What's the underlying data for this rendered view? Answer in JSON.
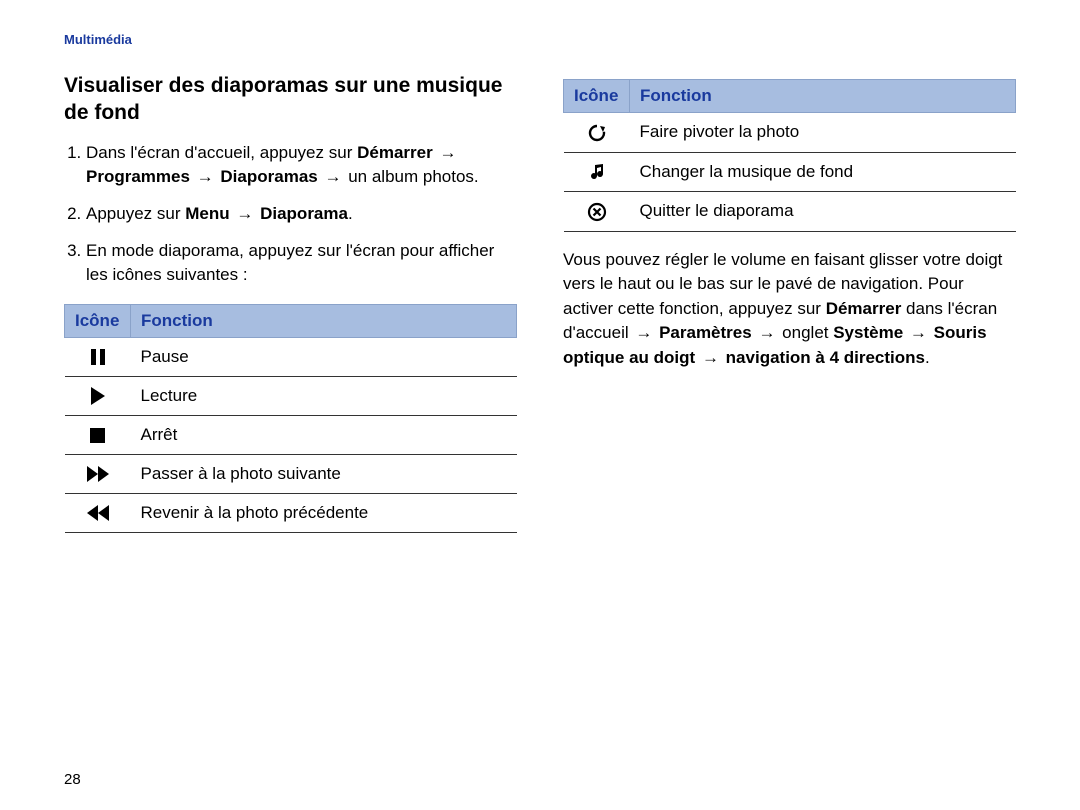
{
  "header": {
    "category": "Multimédia"
  },
  "page_number": "28",
  "left": {
    "title": "Visualiser des diaporamas sur une musique de fond",
    "steps": [
      {
        "lead": "Dans l'écran d'accueil, appuyez sur ",
        "bold1": "Démarrer",
        "bold2": "Programmes",
        "bold3": "Diaporamas",
        "tail": " un album photos."
      },
      {
        "lead": "Appuyez sur ",
        "bold1": "Menu",
        "bold2": "Diaporama",
        "tail": "."
      },
      {
        "plain": "En mode diaporama, appuyez sur l'écran pour afficher les icônes suivantes :"
      }
    ],
    "table": {
      "headers": {
        "icon": "Icône",
        "func": "Fonction"
      },
      "rows": [
        {
          "icon": "pause",
          "label": "Pause"
        },
        {
          "icon": "play",
          "label": "Lecture"
        },
        {
          "icon": "stop",
          "label": "Arrêt"
        },
        {
          "icon": "ffwd",
          "label": "Passer à la photo suivante"
        },
        {
          "icon": "rwd",
          "label": "Revenir à la photo précédente"
        }
      ]
    }
  },
  "right": {
    "table": {
      "headers": {
        "icon": "Icône",
        "func": "Fonction"
      },
      "rows": [
        {
          "icon": "rotate",
          "label": "Faire pivoter la photo"
        },
        {
          "icon": "music",
          "label": "Changer la musique de fond"
        },
        {
          "icon": "close",
          "label": "Quitter le diaporama"
        }
      ]
    },
    "para": {
      "p1": "Vous pouvez régler le volume en faisant glisser votre doigt vers le haut ou le bas sur le pavé de navigation. Pour activer cette fonction, appuyez sur ",
      "b1": "Démarrer",
      "p2": " dans l'écran d'accueil ",
      "b2": "Paramètres",
      "p3": " onglet ",
      "b3": "Système",
      "b4": "Souris optique au doigt",
      "b5": "navigation à 4 directions",
      "end": "."
    }
  },
  "arrow": "→"
}
